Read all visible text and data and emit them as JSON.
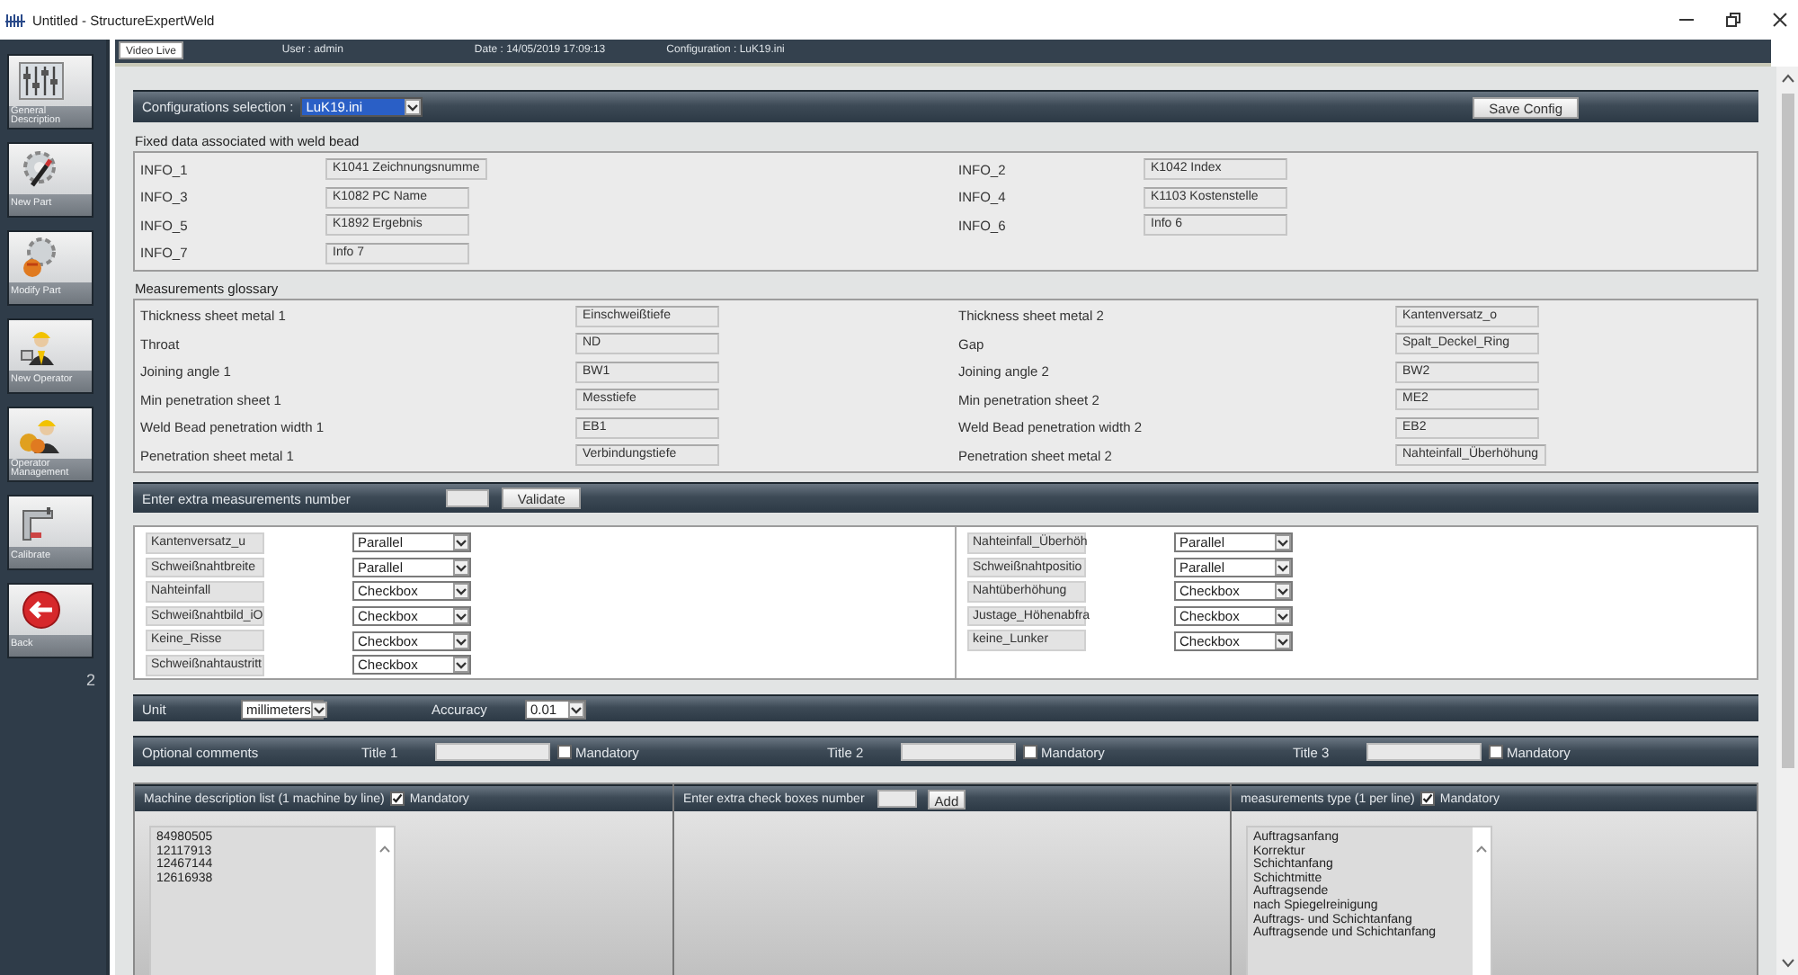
{
  "window": {
    "title": "Untitled - StructureExpertWeld"
  },
  "sidebar": {
    "items": [
      {
        "label": "General Description",
        "kind": "mixer"
      },
      {
        "label": "New Part",
        "kind": "gear-pencil"
      },
      {
        "label": "Modify Part",
        "kind": "gear-hand"
      },
      {
        "label": "New Operator",
        "kind": "worker"
      },
      {
        "label": "Operator Management",
        "kind": "workers"
      },
      {
        "label": "Calibrate",
        "kind": "faucet"
      },
      {
        "label": "Back",
        "kind": "back"
      }
    ],
    "page": "2"
  },
  "header": {
    "tab": "Video Live",
    "user": "User : admin",
    "date": "Date : 14/05/2019 17:09:13",
    "configuration": "Configuration : LuK19.ini"
  },
  "config_bar": {
    "label": "Configurations selection :",
    "value": "LuK19.ini",
    "button": "Save Config"
  },
  "fixed_data": {
    "title": "Fixed data associated with weld bead",
    "fields": [
      {
        "label": "INFO_1",
        "value": "K1041 Zeichnungsnumme"
      },
      {
        "label": "INFO_2",
        "value": "K1042 Index"
      },
      {
        "label": "INFO_3",
        "value": "K1082 PC Name"
      },
      {
        "label": "INFO_4",
        "value": "K1103 Kostenstelle"
      },
      {
        "label": "INFO_5",
        "value": "K1892 Ergebnis"
      },
      {
        "label": "INFO_6",
        "value": "Info 6"
      },
      {
        "label": "INFO_7",
        "value": "Info 7"
      }
    ]
  },
  "glossary": {
    "title": "Measurements glossary",
    "fields": [
      {
        "label": "Thickness sheet metal 1",
        "value": "Einschweißtiefe"
      },
      {
        "label": "Thickness sheet metal 2",
        "value": "Kantenversatz_o"
      },
      {
        "label": "Throat",
        "value": "ND"
      },
      {
        "label": "Gap",
        "value": "Spalt_Deckel_Ring"
      },
      {
        "label": "Joining angle 1",
        "value": "BW1"
      },
      {
        "label": "Joining angle 2",
        "value": "BW2"
      },
      {
        "label": "Min penetration sheet 1",
        "value": "Messtiefe"
      },
      {
        "label": "Min penetration sheet 2",
        "value": "ME2"
      },
      {
        "label": "Weld Bead penetration width 1",
        "value": "EB1"
      },
      {
        "label": "Weld Bead penetration width 2",
        "value": "EB2"
      },
      {
        "label": "Penetration sheet metal 1",
        "value": "Verbindungstiefe"
      },
      {
        "label": "Penetration sheet metal 2",
        "value": "Nahteinfall_Überhöhung"
      }
    ]
  },
  "extra_measurements": {
    "label": "Enter extra measurements number",
    "button": "Validate"
  },
  "measurements": {
    "left": [
      {
        "name": "Kantenversatz_u",
        "type": "Parallel"
      },
      {
        "name": "Schweißnahtbreite",
        "type": "Parallel"
      },
      {
        "name": "Nahteinfall",
        "type": "Checkbox"
      },
      {
        "name": "Schweißnahtbild_iO",
        "type": "Checkbox"
      },
      {
        "name": "Keine_Risse",
        "type": "Checkbox"
      },
      {
        "name": "Schweißnahtaustritt",
        "type": "Checkbox"
      }
    ],
    "right": [
      {
        "name": "Nahteinfall_Überhöh",
        "type": "Parallel"
      },
      {
        "name": "Schweißnahtpositio",
        "type": "Parallel"
      },
      {
        "name": "Nahtüberhöhung",
        "type": "Checkbox"
      },
      {
        "name": "Justage_Höhenabfra",
        "type": "Checkbox"
      },
      {
        "name": "keine_Lunker",
        "type": "Checkbox"
      }
    ]
  },
  "units": {
    "unit_label": "Unit",
    "unit": "millimeters",
    "accuracy_label": "Accuracy",
    "accuracy": "0.01"
  },
  "comments": {
    "label": "Optional comments",
    "titles": [
      {
        "label": "Title 1",
        "mandatory_label": "Mandatory",
        "mandatory": false
      },
      {
        "label": "Title 2",
        "mandatory_label": "Mandatory",
        "mandatory": false
      },
      {
        "label": "Title 3",
        "mandatory_label": "Mandatory",
        "mandatory": false
      }
    ]
  },
  "panels": {
    "machines": {
      "title": "Machine description list (1 machine by line)",
      "mandatory_label": "Mandatory",
      "mandatory": true,
      "lines": [
        "84980505",
        "12117913",
        "12467144",
        "12616938"
      ]
    },
    "check_boxes": {
      "label": "Enter extra check boxes number",
      "button": "Add"
    },
    "measurement_types": {
      "title": "measurements type (1 per line)",
      "mandatory_label": "Mandatory",
      "mandatory": true,
      "lines": [
        "Auftragsanfang",
        "Korrektur",
        "Schichtanfang",
        "Schichtmitte",
        "Auftragsende",
        "nach Spiegelreinigung",
        "Auftrags- und Schichtanfang",
        "Auftragsende und Schichtanfang"
      ]
    }
  }
}
